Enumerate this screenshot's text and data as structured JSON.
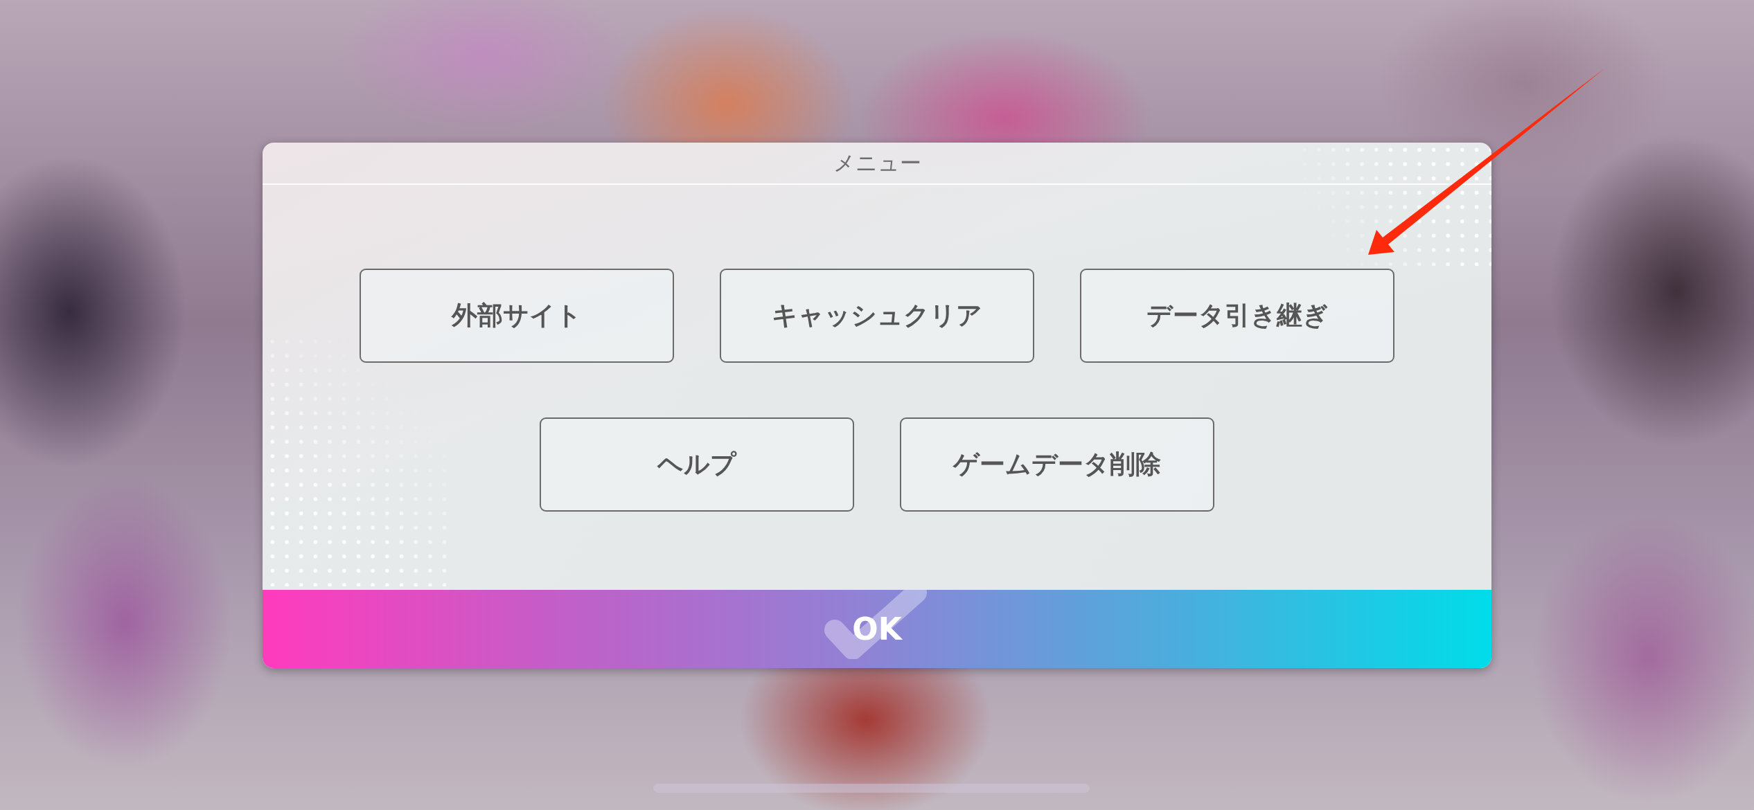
{
  "dialog": {
    "title": "メニュー",
    "button_rows": [
      {
        "buttons": [
          {
            "label": "外部サイト"
          },
          {
            "label": "キャッシュクリア"
          },
          {
            "label": "データ引き継ぎ"
          }
        ]
      },
      {
        "buttons": [
          {
            "label": "ヘルプ"
          },
          {
            "label": "ゲームデータ削除"
          }
        ]
      }
    ],
    "ok_button": {
      "label": "OK"
    }
  }
}
